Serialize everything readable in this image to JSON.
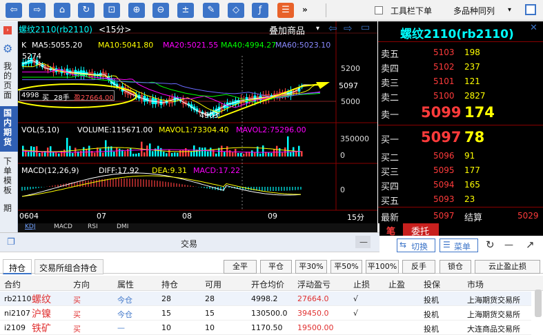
{
  "toolbar": {
    "buttons": [
      "back-icon",
      "forward-icon",
      "home-icon",
      "refresh-icon",
      "crop-icon",
      "zoom-in-icon",
      "zoom-out-icon",
      "calc-icon",
      "pen-icon",
      "tag-icon",
      "fx-icon",
      "list-icon"
    ],
    "more": "»",
    "under_label": "工具栏下单",
    "multi_label": "多品种同列",
    "multi_arrow": "▾"
  },
  "nav": {
    "my_page": "我的页面",
    "domestic_futures": "国内期货",
    "order_template": "下单模板",
    "expiry": "期"
  },
  "chart": {
    "ma_line": {
      "k": "K",
      "ma5": "MA5:5055.20",
      "ma10": "MA10:5041.80",
      "ma20": "MA20:5021.55",
      "ma40": "MA40:4994.27",
      "ma60": "MA60:5023.10"
    },
    "symbol": "螺纹2110(rb2110)",
    "period": "<15分>",
    "overlay": "叠加商品",
    "overlay_arrow": "▾",
    "price_ticks": [
      "5200",
      "5097",
      "5000"
    ],
    "high_label": "5274",
    "low_label": "4903",
    "position_box": {
      "price": "4998",
      "dir": "买",
      "qty": "28手",
      "profit": "盈27664.00"
    },
    "vol_line": {
      "title": "VOL(5,10)",
      "volume": "VOLUME:115671.00",
      "mavol1": "MAVOL1:73304.40",
      "mavol2": "MAVOL2:75296.00"
    },
    "vol_ticks": [
      "350000",
      "0"
    ],
    "macd_line": {
      "title": "MACD(12,26,9)",
      "diff": "DIFF:17.92",
      "dea": "DEA:9.31",
      "macd": "MACD:17.22"
    },
    "macd_ticks": [
      "0"
    ],
    "x_ticks": [
      "0604",
      "07",
      "08",
      "09"
    ],
    "interval": "15分",
    "tabs": [
      "KDJ",
      "MACD",
      "RSI",
      "DMI"
    ],
    "colors": {
      "ma5": "#ffffff",
      "ma10": "#ffff00",
      "ma20": "#ff00ff",
      "ma40": "#00ff00",
      "ma60": "#6a6aff",
      "up": "#ff4040",
      "down": "#00ffff"
    }
  },
  "orderbook": {
    "title": "螺纹2110(rb2110)",
    "asks": [
      {
        "label": "卖五",
        "price": "5103",
        "vol": "198"
      },
      {
        "label": "卖四",
        "price": "5102",
        "vol": "237"
      },
      {
        "label": "卖三",
        "price": "5101",
        "vol": "121"
      },
      {
        "label": "卖二",
        "price": "5100",
        "vol": "2827"
      }
    ],
    "ask1": {
      "label": "卖一",
      "price": "5099",
      "vol": "174"
    },
    "bid1": {
      "label": "买一",
      "price": "5097",
      "vol": "78"
    },
    "bids": [
      {
        "label": "买二",
        "price": "5096",
        "vol": "91"
      },
      {
        "label": "买三",
        "price": "5095",
        "vol": "177"
      },
      {
        "label": "买四",
        "price": "5094",
        "vol": "165"
      },
      {
        "label": "买五",
        "price": "5093",
        "vol": "23"
      }
    ],
    "last_label": "最新",
    "last": "5097",
    "settle_label": "结算",
    "settle": "5029",
    "tab_pen": "笔",
    "tab_order": "委托"
  },
  "right": {
    "switch": "切换",
    "menu": "菜单"
  },
  "trade": {
    "title": "交易",
    "tabs": [
      "持仓",
      "交易所组合持仓"
    ],
    "buttons": [
      "全平",
      "平仓",
      "平30%",
      "平50%",
      "平100%",
      "反手",
      "锁仓",
      "云止盈止损"
    ],
    "headers": [
      "合约",
      "方向",
      "属性",
      "持仓",
      "可用",
      "开仓均价",
      "浮动盈亏",
      "止损",
      "止盈",
      "投保",
      "市场"
    ],
    "rows": [
      {
        "code": "rb2110",
        "name": "螺纹",
        "dir": "买",
        "attr": "今仓",
        "pos": "28",
        "avail": "28",
        "avg": "4998.2",
        "pnl": "27664.0",
        "sl": "√",
        "hedge": "投机",
        "market": "上海期货交易所"
      },
      {
        "code": "ni2107",
        "name": "沪镍",
        "dir": "买",
        "attr": "今仓",
        "pos": "15",
        "avail": "15",
        "avg": "130500.0",
        "pnl": "39450.0",
        "sl": "√",
        "hedge": "投机",
        "market": "上海期货交易所"
      },
      {
        "code": "i2109",
        "name": "铁矿",
        "dir": "买",
        "attr": "—",
        "pos": "10",
        "avail": "10",
        "avg": "1170.50",
        "pnl": "19500.00",
        "sl": "",
        "hedge": "投机",
        "market": "大连商品交易所"
      }
    ]
  }
}
